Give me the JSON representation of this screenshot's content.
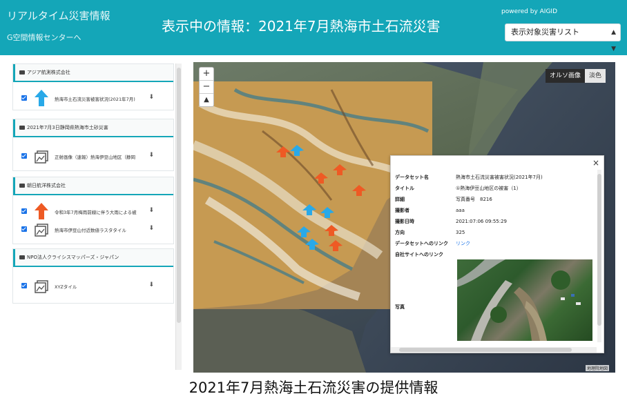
{
  "header": {
    "app_title": "リアルタイム災害情報",
    "center_link": "G空間情報センターへ",
    "page_title": "表示中の情報：2021年7月熱海市土石流災害",
    "powered_by": "powered by AIGID",
    "select_value": "表示対象災害リスト",
    "bg_color": "#14a6b8"
  },
  "sidebar": {
    "groups": [
      {
        "title": "アジア航測株式会社",
        "items": [
          {
            "label": "熱海市土石流災害被害状況(2021年7月)",
            "icon": "arrow-up-blue-icon",
            "checked": true
          }
        ]
      },
      {
        "title": "2021年7月3日静岡県熱海市土砂災害",
        "items": [
          {
            "label": "正射画像（速報）熱海伊豆山地区（静岡",
            "icon": "image-layer-icon",
            "checked": true
          }
        ]
      },
      {
        "title": "朝日航洋株式会社",
        "items": [
          {
            "label": "令和3年7月梅雨前線に伴う大雨による被",
            "icon": "arrow-up-orange-icon",
            "checked": true
          },
          {
            "label": "熱海市伊豆山付近数値ラスタタイル",
            "icon": "image-layer-icon",
            "checked": true
          }
        ]
      },
      {
        "title": "NPO法人クライシスマッパーズ・ジャパン",
        "items": [
          {
            "label": "XYZタイル",
            "icon": "image-layer-icon",
            "checked": true
          }
        ]
      }
    ]
  },
  "map": {
    "zoom_in": "+",
    "zoom_out": "−",
    "reset_north": "▲",
    "layer_active": "オルソ画像",
    "layer_inactive": "淡色",
    "attribution": "地理院地図"
  },
  "popup": {
    "close": "×",
    "rows": [
      {
        "key": "データセット名",
        "value": "熱海市土石流災害被害状況(2021年7月)"
      },
      {
        "key": "タイトル",
        "value": "①熱海伊豆山地区の被害（1）"
      },
      {
        "key": "詳細",
        "value": "写真番号　8216"
      },
      {
        "key": "撮影者",
        "value": "aaa"
      },
      {
        "key": "撮影日時",
        "value": "2021:07:06 09:55:29"
      },
      {
        "key": "方向",
        "value": "325"
      },
      {
        "key": "データセットへのリンク",
        "value": "リンク"
      },
      {
        "key": "自社サイトへのリンク",
        "value": ""
      },
      {
        "key": "写真",
        "value": ""
      }
    ]
  },
  "caption": "2021年7月熱海土石流災害の提供情報"
}
